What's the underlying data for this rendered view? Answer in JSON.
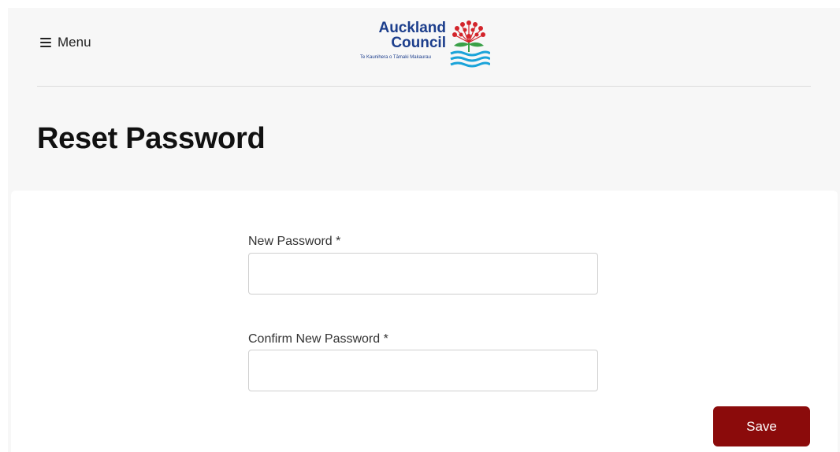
{
  "header": {
    "menu_label": "Menu",
    "menu_icon": "hamburger-icon",
    "logo": {
      "line1": "Auckland",
      "line2": "Council",
      "subtitle": "Te Kaunihera o Tāmaki Makaurau"
    }
  },
  "page": {
    "title": "Reset Password"
  },
  "form": {
    "new_password": {
      "label": "New Password *",
      "value": ""
    },
    "confirm_password": {
      "label": "Confirm New Password *",
      "value": ""
    },
    "save_label": "Save"
  },
  "colors": {
    "brand_blue": "#1c3e8c",
    "button_red": "#8b0b0b",
    "page_background": "#f7f7f7"
  }
}
